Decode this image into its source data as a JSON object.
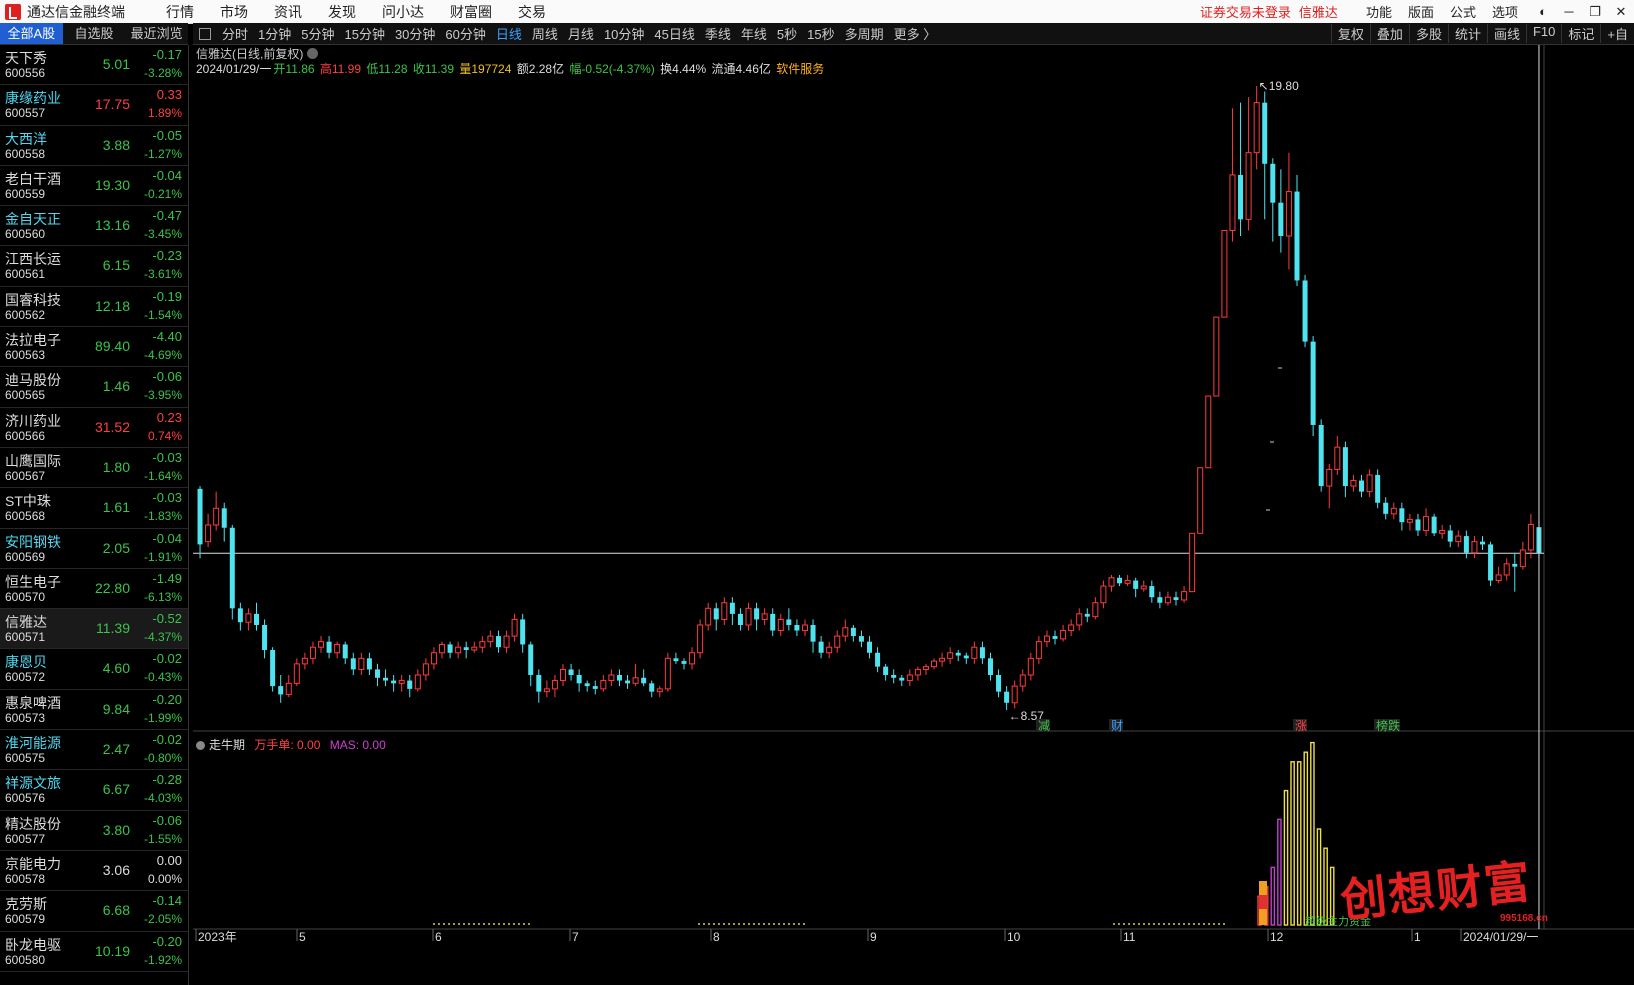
{
  "window": {
    "title": "通达信金融终端",
    "menu": [
      "行情",
      "市场",
      "资讯",
      "发现",
      "问小达",
      "财富圈",
      "交易"
    ],
    "notice": "证券交易未登录",
    "current_stock": "信雅达",
    "right_menu": [
      "功能",
      "版面",
      "公式",
      "选项"
    ]
  },
  "list_tabs": [
    "全部A股",
    "自选股",
    "最近浏览"
  ],
  "stocks": [
    {
      "name": "天下秀",
      "code": "600556",
      "price": "5.01",
      "change": "-0.17",
      "pct": "-3.28%",
      "dir": "dn",
      "blue": false
    },
    {
      "name": "康缘药业",
      "code": "600557",
      "price": "17.75",
      "change": "0.33",
      "pct": "1.89%",
      "dir": "up",
      "blue": true
    },
    {
      "name": "大西洋",
      "code": "600558",
      "price": "3.88",
      "change": "-0.05",
      "pct": "-1.27%",
      "dir": "dn",
      "blue": true
    },
    {
      "name": "老白干酒",
      "code": "600559",
      "price": "19.30",
      "change": "-0.04",
      "pct": "-0.21%",
      "dir": "dn",
      "blue": false
    },
    {
      "name": "金自天正",
      "code": "600560",
      "price": "13.16",
      "change": "-0.47",
      "pct": "-3.45%",
      "dir": "dn",
      "blue": true
    },
    {
      "name": "江西长运",
      "code": "600561",
      "price": "6.15",
      "change": "-0.23",
      "pct": "-3.61%",
      "dir": "dn",
      "blue": false
    },
    {
      "name": "国睿科技",
      "code": "600562",
      "price": "12.18",
      "change": "-0.19",
      "pct": "-1.54%",
      "dir": "dn",
      "blue": false
    },
    {
      "name": "法拉电子",
      "code": "600563",
      "price": "89.40",
      "change": "-4.40",
      "pct": "-4.69%",
      "dir": "dn",
      "blue": false
    },
    {
      "name": "迪马股份",
      "code": "600565",
      "price": "1.46",
      "change": "-0.06",
      "pct": "-3.95%",
      "dir": "dn",
      "blue": false
    },
    {
      "name": "济川药业",
      "code": "600566",
      "price": "31.52",
      "change": "0.23",
      "pct": "0.74%",
      "dir": "up",
      "blue": false
    },
    {
      "name": "山鹰国际",
      "code": "600567",
      "price": "1.80",
      "change": "-0.03",
      "pct": "-1.64%",
      "dir": "dn",
      "blue": false
    },
    {
      "name": "ST中珠",
      "code": "600568",
      "price": "1.61",
      "change": "-0.03",
      "pct": "-1.83%",
      "dir": "dn",
      "blue": false
    },
    {
      "name": "安阳钢铁",
      "code": "600569",
      "price": "2.05",
      "change": "-0.04",
      "pct": "-1.91%",
      "dir": "dn",
      "blue": true
    },
    {
      "name": "恒生电子",
      "code": "600570",
      "price": "22.80",
      "change": "-1.49",
      "pct": "-6.13%",
      "dir": "dn",
      "blue": false
    },
    {
      "name": "信雅达",
      "code": "600571",
      "price": "11.39",
      "change": "-0.52",
      "pct": "-4.37%",
      "dir": "dn",
      "blue": false,
      "sel": true
    },
    {
      "name": "康恩贝",
      "code": "600572",
      "price": "4.60",
      "change": "-0.02",
      "pct": "-0.43%",
      "dir": "dn",
      "blue": true
    },
    {
      "name": "惠泉啤酒",
      "code": "600573",
      "price": "9.84",
      "change": "-0.20",
      "pct": "-1.99%",
      "dir": "dn",
      "blue": false
    },
    {
      "name": "淮河能源",
      "code": "600575",
      "price": "2.47",
      "change": "-0.02",
      "pct": "-0.80%",
      "dir": "dn",
      "blue": true
    },
    {
      "name": "祥源文旅",
      "code": "600576",
      "price": "6.67",
      "change": "-0.28",
      "pct": "-4.03%",
      "dir": "dn",
      "blue": true
    },
    {
      "name": "精达股份",
      "code": "600577",
      "price": "3.80",
      "change": "-0.06",
      "pct": "-1.55%",
      "dir": "dn",
      "blue": false
    },
    {
      "name": "京能电力",
      "code": "600578",
      "price": "3.06",
      "change": "0.00",
      "pct": "0.00%",
      "dir": "fl",
      "blue": false
    },
    {
      "name": "克劳斯",
      "code": "600579",
      "price": "6.68",
      "change": "-0.14",
      "pct": "-2.05%",
      "dir": "dn",
      "blue": false
    },
    {
      "name": "卧龙电驱",
      "code": "600580",
      "price": "10.19",
      "change": "-0.20",
      "pct": "-1.92%",
      "dir": "dn",
      "blue": false
    }
  ],
  "periods": [
    "分时",
    "1分钟",
    "5分钟",
    "15分钟",
    "30分钟",
    "60分钟",
    "日线",
    "周线",
    "月线",
    "10分钟",
    "45日线",
    "季线",
    "年线",
    "5秒",
    "15秒",
    "多周期",
    "更多 〉"
  ],
  "active_period": "日线",
  "tools": [
    "复权",
    "叠加",
    "多股",
    "统计",
    "画线",
    "F10",
    "标记",
    "+自"
  ],
  "chart_info": {
    "title": "信雅达(日线,前复权)",
    "date": "2024/01/29/一",
    "open": "开11.86",
    "high": "高11.99",
    "low": "低11.28",
    "close": "收11.39",
    "vol": "量197724",
    "amount": "额2.28亿",
    "change": "幅-0.52(-4.37%)",
    "turnover": "换4.44%",
    "float_cap": "流通4.46亿",
    "sector": "软件服务"
  },
  "markers": {
    "high_label": "19.80",
    "low_label": "8.57",
    "events": [
      {
        "text": "减",
        "color": "#3cc34a"
      },
      {
        "text": "财",
        "color": "#3aa0ff"
      },
      {
        "text": "涨",
        "color": "#ff4040"
      },
      {
        "text": "榜跌",
        "color": "#3cc34a"
      }
    ]
  },
  "indicator": {
    "name": "走牛期",
    "wsd_label": "万手单: 0.00",
    "mas_label": "MAS: 0.00",
    "overlay_text": "超级主力资金"
  },
  "x_axis_labels": [
    "2023年",
    "5",
    "6",
    "7",
    "8",
    "9",
    "10",
    "11",
    "12",
    "1",
    "2024/01/29/一"
  ],
  "watermark": {
    "text": "创想财富",
    "url": "995168.cn"
  },
  "chart_data": {
    "type": "candlestick",
    "title": "信雅达(日线,前复权)",
    "ylim": [
      8.0,
      20.5
    ],
    "high": 19.8,
    "low": 8.57,
    "last_close": 11.39,
    "candles": [
      [
        12.55,
        11.55,
        11.3,
        12.6
      ],
      [
        11.6,
        11.9,
        11.5,
        12.1
      ],
      [
        11.9,
        12.2,
        11.8,
        12.5
      ],
      [
        12.2,
        11.85,
        11.6,
        12.3
      ],
      [
        11.85,
        10.4,
        10.2,
        11.9
      ],
      [
        10.4,
        10.15,
        10.0,
        10.5
      ],
      [
        10.15,
        10.3,
        10.0,
        10.4
      ],
      [
        10.3,
        10.1,
        10.0,
        10.5
      ],
      [
        10.1,
        9.65,
        9.5,
        10.2
      ],
      [
        9.65,
        9.0,
        8.9,
        9.7
      ],
      [
        9.0,
        8.85,
        8.7,
        9.2
      ],
      [
        8.85,
        9.05,
        8.8,
        9.2
      ],
      [
        9.05,
        9.4,
        9.0,
        9.5
      ],
      [
        9.4,
        9.5,
        9.3,
        9.6
      ],
      [
        9.5,
        9.7,
        9.4,
        9.8
      ],
      [
        9.7,
        9.8,
        9.6,
        9.9
      ],
      [
        9.8,
        9.6,
        9.5,
        9.9
      ],
      [
        9.6,
        9.75,
        9.5,
        9.8
      ],
      [
        9.75,
        9.5,
        9.4,
        9.8
      ],
      [
        9.5,
        9.3,
        9.2,
        9.6
      ],
      [
        9.3,
        9.5,
        9.2,
        9.6
      ],
      [
        9.5,
        9.3,
        9.2,
        9.6
      ],
      [
        9.3,
        9.15,
        9.0,
        9.4
      ],
      [
        9.15,
        9.1,
        9.0,
        9.3
      ],
      [
        9.1,
        9.05,
        8.9,
        9.2
      ],
      [
        9.05,
        9.1,
        8.9,
        9.2
      ],
      [
        9.1,
        8.95,
        8.8,
        9.2
      ],
      [
        8.95,
        9.2,
        8.9,
        9.3
      ],
      [
        9.2,
        9.4,
        9.1,
        9.5
      ],
      [
        9.4,
        9.6,
        9.3,
        9.7
      ],
      [
        9.6,
        9.75,
        9.5,
        9.8
      ],
      [
        9.75,
        9.6,
        9.5,
        9.8
      ],
      [
        9.6,
        9.7,
        9.5,
        9.8
      ],
      [
        9.7,
        9.65,
        9.5,
        9.8
      ],
      [
        9.65,
        9.7,
        9.6,
        9.8
      ],
      [
        9.7,
        9.8,
        9.6,
        9.9
      ],
      [
        9.8,
        9.9,
        9.7,
        10.0
      ],
      [
        9.9,
        9.7,
        9.6,
        10.0
      ],
      [
        9.7,
        9.9,
        9.6,
        10.0
      ],
      [
        9.9,
        10.2,
        9.8,
        10.3
      ],
      [
        10.2,
        9.75,
        9.6,
        10.3
      ],
      [
        9.75,
        9.2,
        9.0,
        9.8
      ],
      [
        9.2,
        8.9,
        8.7,
        9.3
      ],
      [
        8.9,
        8.95,
        8.8,
        9.1
      ],
      [
        8.95,
        9.1,
        8.8,
        9.2
      ],
      [
        9.1,
        9.3,
        9.0,
        9.4
      ],
      [
        9.3,
        9.2,
        9.1,
        9.4
      ],
      [
        9.2,
        9.05,
        8.9,
        9.3
      ],
      [
        9.05,
        9.0,
        8.9,
        9.1
      ],
      [
        9.0,
        8.95,
        8.85,
        9.1
      ],
      [
        8.95,
        9.1,
        8.9,
        9.2
      ],
      [
        9.1,
        9.2,
        9.0,
        9.3
      ],
      [
        9.2,
        9.1,
        9.0,
        9.3
      ],
      [
        9.1,
        9.05,
        8.95,
        9.2
      ],
      [
        9.05,
        9.15,
        9.0,
        9.4
      ],
      [
        9.15,
        9.05,
        9.0,
        9.3
      ],
      [
        9.05,
        8.9,
        8.8,
        9.1
      ],
      [
        8.9,
        8.95,
        8.8,
        9.0
      ],
      [
        8.95,
        9.5,
        8.9,
        9.6
      ],
      [
        9.5,
        9.45,
        9.4,
        9.6
      ],
      [
        9.45,
        9.4,
        9.3,
        9.5
      ],
      [
        9.4,
        9.6,
        9.3,
        9.7
      ],
      [
        9.6,
        10.1,
        9.5,
        10.2
      ],
      [
        10.1,
        10.4,
        10.0,
        10.5
      ],
      [
        10.4,
        10.2,
        10.0,
        10.5
      ],
      [
        10.2,
        10.5,
        10.1,
        10.6
      ],
      [
        10.5,
        10.3,
        10.1,
        10.6
      ],
      [
        10.3,
        10.1,
        10.0,
        10.4
      ],
      [
        10.1,
        10.4,
        10.0,
        10.5
      ],
      [
        10.4,
        10.2,
        10.0,
        10.5
      ],
      [
        10.2,
        10.3,
        10.1,
        10.4
      ],
      [
        10.3,
        10.0,
        9.9,
        10.4
      ],
      [
        10.0,
        10.2,
        9.9,
        10.3
      ],
      [
        10.2,
        10.1,
        10.0,
        10.4
      ],
      [
        10.1,
        10.0,
        9.9,
        10.2
      ],
      [
        10.0,
        10.1,
        9.9,
        10.2
      ],
      [
        10.1,
        9.8,
        9.6,
        10.2
      ],
      [
        9.8,
        9.6,
        9.5,
        9.9
      ],
      [
        9.6,
        9.7,
        9.5,
        9.8
      ],
      [
        9.7,
        9.9,
        9.6,
        10.0
      ],
      [
        9.9,
        10.05,
        9.8,
        10.2
      ],
      [
        10.05,
        9.9,
        9.8,
        10.1
      ],
      [
        9.9,
        9.8,
        9.7,
        10.0
      ],
      [
        9.8,
        9.6,
        9.5,
        9.9
      ],
      [
        9.6,
        9.35,
        9.25,
        9.7
      ],
      [
        9.35,
        9.2,
        9.1,
        9.4
      ],
      [
        9.2,
        9.15,
        9.05,
        9.3
      ],
      [
        9.15,
        9.1,
        9.0,
        9.2
      ],
      [
        9.1,
        9.2,
        9.0,
        9.3
      ],
      [
        9.2,
        9.3,
        9.1,
        9.35
      ],
      [
        9.3,
        9.35,
        9.2,
        9.4
      ],
      [
        9.35,
        9.45,
        9.3,
        9.5
      ],
      [
        9.45,
        9.5,
        9.35,
        9.6
      ],
      [
        9.5,
        9.6,
        9.4,
        9.7
      ],
      [
        9.6,
        9.55,
        9.45,
        9.65
      ],
      [
        9.55,
        9.5,
        9.4,
        9.6
      ],
      [
        9.5,
        9.7,
        9.4,
        9.8
      ],
      [
        9.7,
        9.5,
        9.4,
        9.8
      ],
      [
        9.5,
        9.2,
        9.1,
        9.6
      ],
      [
        9.2,
        8.9,
        8.8,
        9.3
      ],
      [
        8.9,
        8.7,
        8.57,
        9.0
      ],
      [
        8.7,
        9.0,
        8.6,
        9.1
      ],
      [
        9.0,
        9.2,
        8.9,
        9.3
      ],
      [
        9.2,
        9.5,
        9.1,
        9.6
      ],
      [
        9.5,
        9.8,
        9.4,
        9.9
      ],
      [
        9.8,
        9.9,
        9.7,
        10.0
      ],
      [
        9.9,
        9.85,
        9.75,
        10.0
      ],
      [
        9.85,
        10.0,
        9.8,
        10.1
      ],
      [
        10.0,
        10.1,
        9.9,
        10.2
      ],
      [
        10.1,
        10.3,
        10.0,
        10.4
      ],
      [
        10.3,
        10.25,
        10.15,
        10.4
      ],
      [
        10.25,
        10.5,
        10.2,
        10.6
      ],
      [
        10.5,
        10.8,
        10.4,
        10.9
      ],
      [
        10.8,
        10.95,
        10.7,
        11.0
      ],
      [
        10.95,
        10.85,
        10.8,
        11.0
      ],
      [
        10.85,
        10.9,
        10.8,
        11.0
      ],
      [
        10.9,
        10.75,
        10.6,
        10.95
      ],
      [
        10.75,
        10.8,
        10.7,
        10.9
      ],
      [
        10.8,
        10.6,
        10.5,
        10.9
      ],
      [
        10.6,
        10.5,
        10.4,
        10.7
      ],
      [
        10.5,
        10.6,
        10.45,
        10.7
      ],
      [
        10.6,
        10.55,
        10.45,
        10.7
      ],
      [
        10.55,
        10.7,
        10.5,
        10.8
      ],
      [
        10.7,
        11.75,
        10.7,
        11.75
      ],
      [
        11.75,
        12.93,
        11.75,
        12.93
      ],
      [
        12.93,
        14.22,
        12.93,
        14.22
      ],
      [
        14.22,
        15.64,
        14.22,
        15.64
      ],
      [
        15.64,
        17.2,
        15.64,
        17.2
      ],
      [
        17.2,
        18.2,
        17.0,
        19.4
      ],
      [
        18.2,
        17.4,
        17.1,
        19.5
      ],
      [
        17.4,
        18.6,
        17.2,
        19.6
      ],
      [
        18.6,
        19.5,
        18.3,
        19.8
      ],
      [
        19.5,
        18.4,
        17.4,
        19.7
      ],
      [
        18.4,
        17.7,
        17.0,
        18.5
      ],
      [
        17.7,
        17.1,
        16.8,
        18.3
      ],
      [
        17.1,
        17.9,
        16.5,
        18.6
      ],
      [
        17.9,
        16.3,
        16.2,
        18.2
      ],
      [
        16.3,
        15.2,
        15.1,
        16.4
      ],
      [
        15.2,
        13.7,
        13.5,
        15.3
      ],
      [
        13.7,
        12.6,
        12.5,
        13.8
      ],
      [
        12.6,
        12.9,
        12.2,
        13.0
      ],
      [
        12.9,
        13.3,
        12.8,
        13.5
      ],
      [
        13.3,
        12.6,
        12.4,
        13.4
      ],
      [
        12.6,
        12.7,
        12.5,
        12.8
      ],
      [
        12.7,
        12.5,
        12.4,
        12.8
      ],
      [
        12.5,
        12.8,
        12.4,
        12.9
      ],
      [
        12.8,
        12.3,
        12.2,
        12.9
      ],
      [
        12.3,
        12.1,
        12.0,
        12.4
      ],
      [
        12.1,
        12.2,
        12.0,
        12.3
      ],
      [
        12.2,
        11.95,
        11.8,
        12.3
      ],
      [
        11.95,
        12.0,
        11.8,
        12.1
      ],
      [
        12.0,
        11.8,
        11.7,
        12.1
      ],
      [
        11.8,
        12.05,
        11.7,
        12.2
      ],
      [
        12.05,
        11.75,
        11.7,
        12.1
      ],
      [
        11.75,
        11.8,
        11.65,
        11.9
      ],
      [
        11.8,
        11.6,
        11.5,
        11.9
      ],
      [
        11.6,
        11.7,
        11.5,
        11.8
      ],
      [
        11.7,
        11.4,
        11.3,
        11.8
      ],
      [
        11.4,
        11.6,
        11.3,
        11.7
      ],
      [
        11.6,
        11.55,
        11.45,
        11.7
      ],
      [
        11.55,
        10.9,
        10.8,
        11.6
      ],
      [
        10.9,
        11.0,
        10.85,
        11.15
      ],
      [
        11.0,
        11.2,
        10.9,
        11.3
      ],
      [
        11.2,
        11.15,
        10.7,
        11.4
      ],
      [
        11.15,
        11.45,
        11.1,
        11.6
      ],
      [
        11.45,
        11.91,
        11.3,
        12.1
      ],
      [
        11.86,
        11.39,
        11.28,
        11.99
      ]
    ],
    "indicator_series": {
      "name": "走牛期",
      "values_last_days": [
        3,
        4,
        6,
        11,
        14,
        17,
        17,
        18,
        19,
        10,
        8,
        6
      ]
    },
    "x_tick_labels": [
      "2023年",
      "5",
      "6",
      "7",
      "8",
      "9",
      "10",
      "11",
      "12",
      "1",
      "2024/01/29/一"
    ]
  }
}
